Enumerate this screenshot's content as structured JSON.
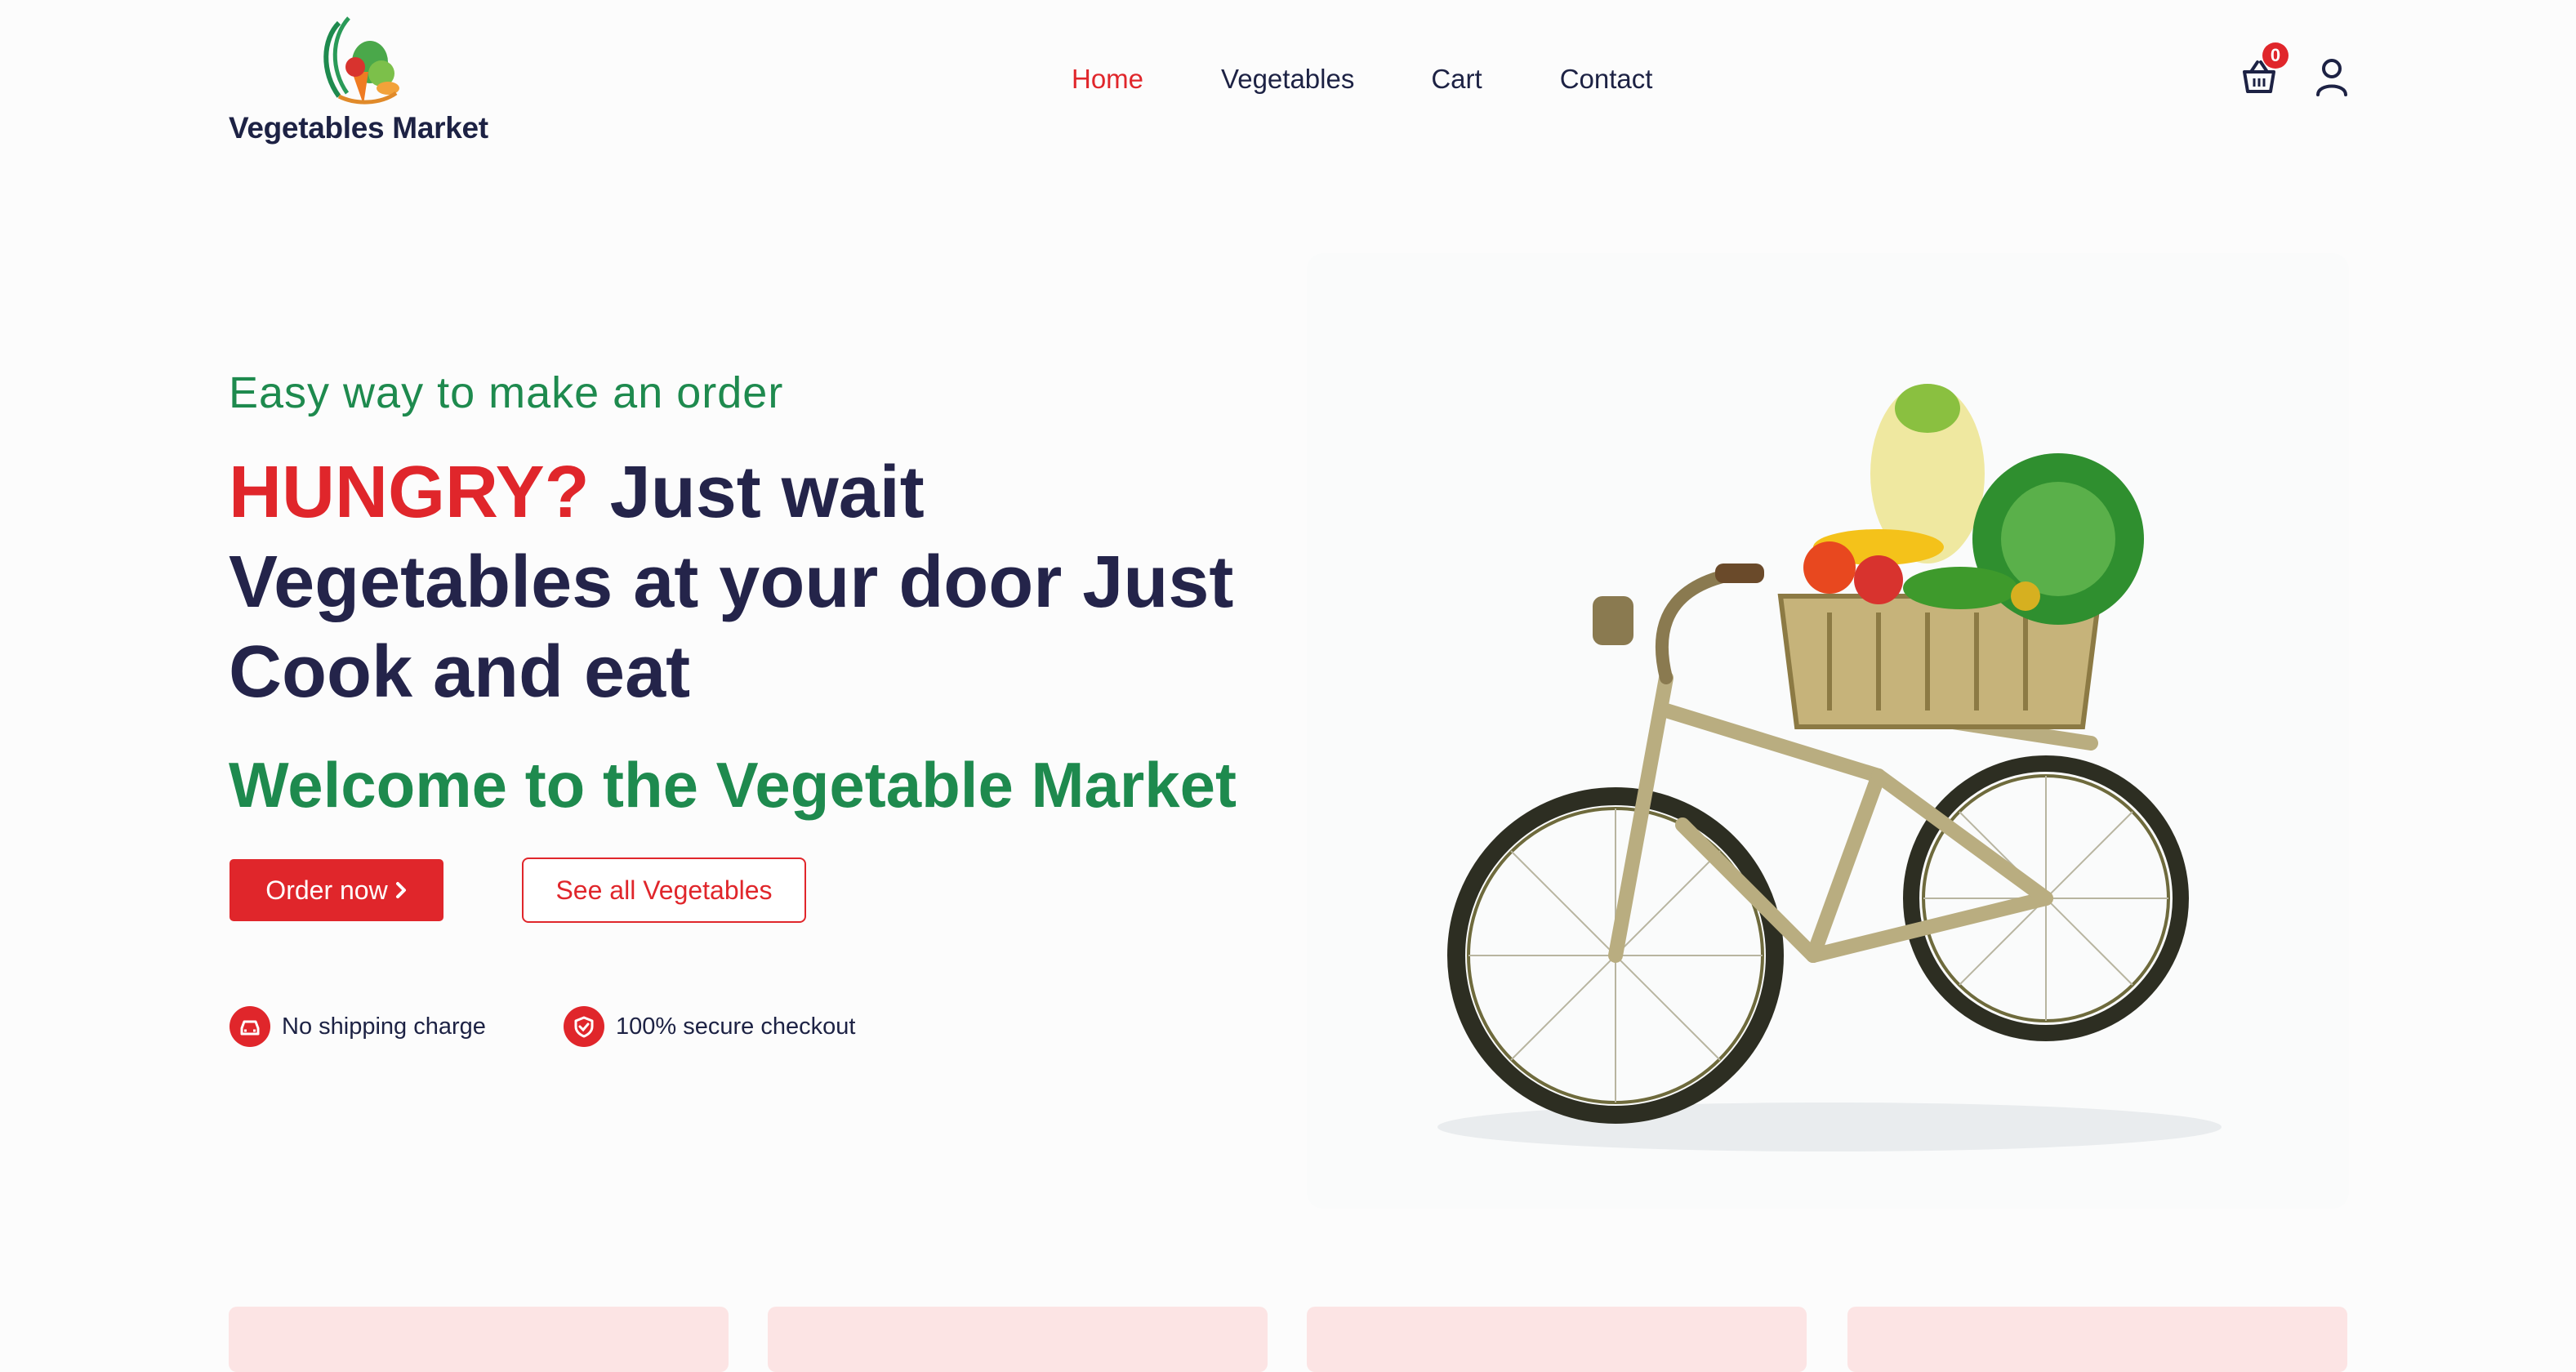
{
  "brand": {
    "name": "Vegetables Market"
  },
  "nav": {
    "items": [
      {
        "label": "Home",
        "active": true
      },
      {
        "label": "Vegetables",
        "active": false
      },
      {
        "label": "Cart",
        "active": false
      },
      {
        "label": "Contact",
        "active": false
      }
    ]
  },
  "header": {
    "cart_count": "0",
    "cart_icon": "basket-icon",
    "user_icon": "user-icon"
  },
  "hero": {
    "subtitle": "Easy way to make an order",
    "headline_highlight": "HUNGRY?",
    "headline_rest": " Just wait Vegetables at your door Just Cook and eat",
    "welcome": "Welcome to the Vegetable Market",
    "order_button": "Order now",
    "order_button_icon": "chevron-right-icon",
    "see_all_button": "See all Vegetables",
    "features": [
      {
        "icon": "car-icon",
        "label": "No shipping charge"
      },
      {
        "icon": "shield-check-icon",
        "label": "100% secure checkout"
      }
    ],
    "image": "bicycle with vegetable basket"
  },
  "colors": {
    "accent_red": "#e0262b",
    "accent_green": "#1e8a4e",
    "text_dark": "#24244a",
    "card_pink": "#fce4e4"
  }
}
